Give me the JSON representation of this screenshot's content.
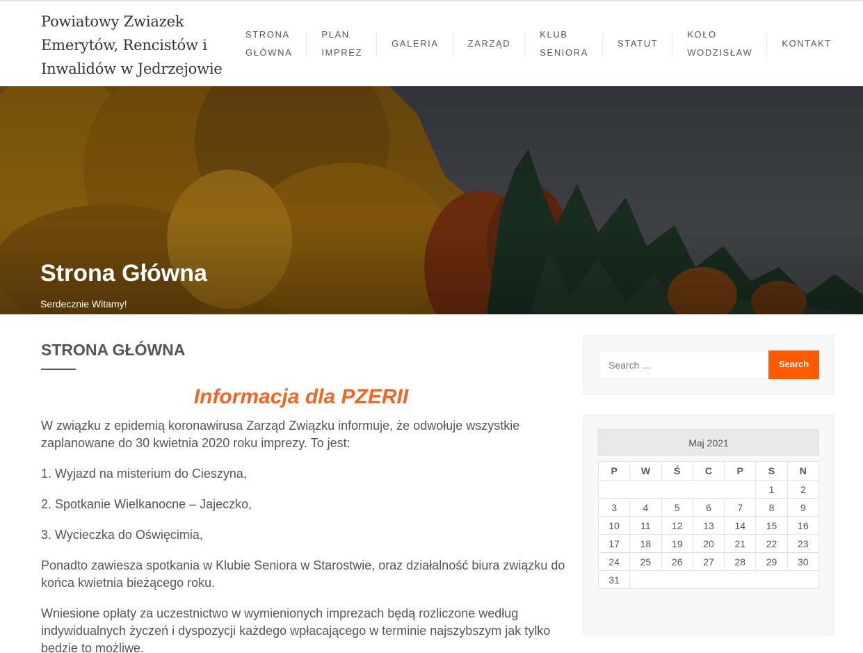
{
  "site": {
    "title": "Powiatowy Zwiazek Emerytów, Rencistów i Inwalidów w Jedrzejowie"
  },
  "nav": {
    "items": [
      {
        "label": "STRONA GŁÓWNA",
        "line1": "STRONA",
        "line2": "GŁÓWNA"
      },
      {
        "label": "PLAN IMPREZ",
        "line1": "PLAN",
        "line2": "IMPREZ"
      },
      {
        "label": "GALERIA",
        "line1": "GALERIA",
        "line2": ""
      },
      {
        "label": "ZARZĄD",
        "line1": "ZARZĄD",
        "line2": ""
      },
      {
        "label": "KLUB SENIORA",
        "line1": "KLUB",
        "line2": "SENIORA"
      },
      {
        "label": "STATUT",
        "line1": "STATUT",
        "line2": ""
      },
      {
        "label": "KOŁO WODZISŁAW",
        "line1": "KOŁO",
        "line2": "WODZISŁAW"
      },
      {
        "label": "KONTAKT",
        "line1": "KONTAKT",
        "line2": ""
      }
    ]
  },
  "hero": {
    "title": "Strona Główna",
    "subtitle": "Serdecznie Witamy!"
  },
  "content": {
    "heading": "STRONA GŁÓWNA",
    "info_title": "Informacja dla PZERII",
    "paragraphs": [
      "W związku z epidemią koronawirusa Zarząd Związku informuje, że odwołuje wszystkie zaplanowane do 30 kwietnia 2020 roku imprezy. To jest:",
      "1. Wyjazd na misterium do Cieszyna,",
      "2. Spotkanie Wielkanocne – Jajeczko,",
      "3.  Wycieczka do Oświęcimia,",
      "Ponadto zawiesza spotkania w Klubie Seniora w Starostwie, oraz działalność biura związku do końca kwietnia bieżącego roku.",
      "Wniesione opłaty za uczestnictwo w wymienionych imprezach będą rozliczone według indywidualnych życzeń i dyspozycji każdego wpłacającego w terminie najszybszym jak tylko będzie to możliwe."
    ]
  },
  "sidebar": {
    "search": {
      "placeholder": "Search …",
      "button_label": "Search"
    },
    "calendar": {
      "caption": "Maj 2021",
      "weekdays": [
        "P",
        "W",
        "Ś",
        "C",
        "P",
        "S",
        "N"
      ],
      "weeks": [
        [
          "",
          "",
          "",
          "",
          "",
          "1",
          "2"
        ],
        [
          "3",
          "4",
          "5",
          "6",
          "7",
          "8",
          "9"
        ],
        [
          "10",
          "11",
          "12",
          "13",
          "14",
          "15",
          "16"
        ],
        [
          "17",
          "18",
          "19",
          "20",
          "21",
          "22",
          "23"
        ],
        [
          "24",
          "25",
          "26",
          "27",
          "28",
          "29",
          "30"
        ],
        [
          "31",
          "",
          "",
          "",
          "",
          "",
          ""
        ]
      ]
    }
  },
  "colors": {
    "accent": "#ff5a00",
    "info_title": "#f26522",
    "text": "#555555"
  }
}
